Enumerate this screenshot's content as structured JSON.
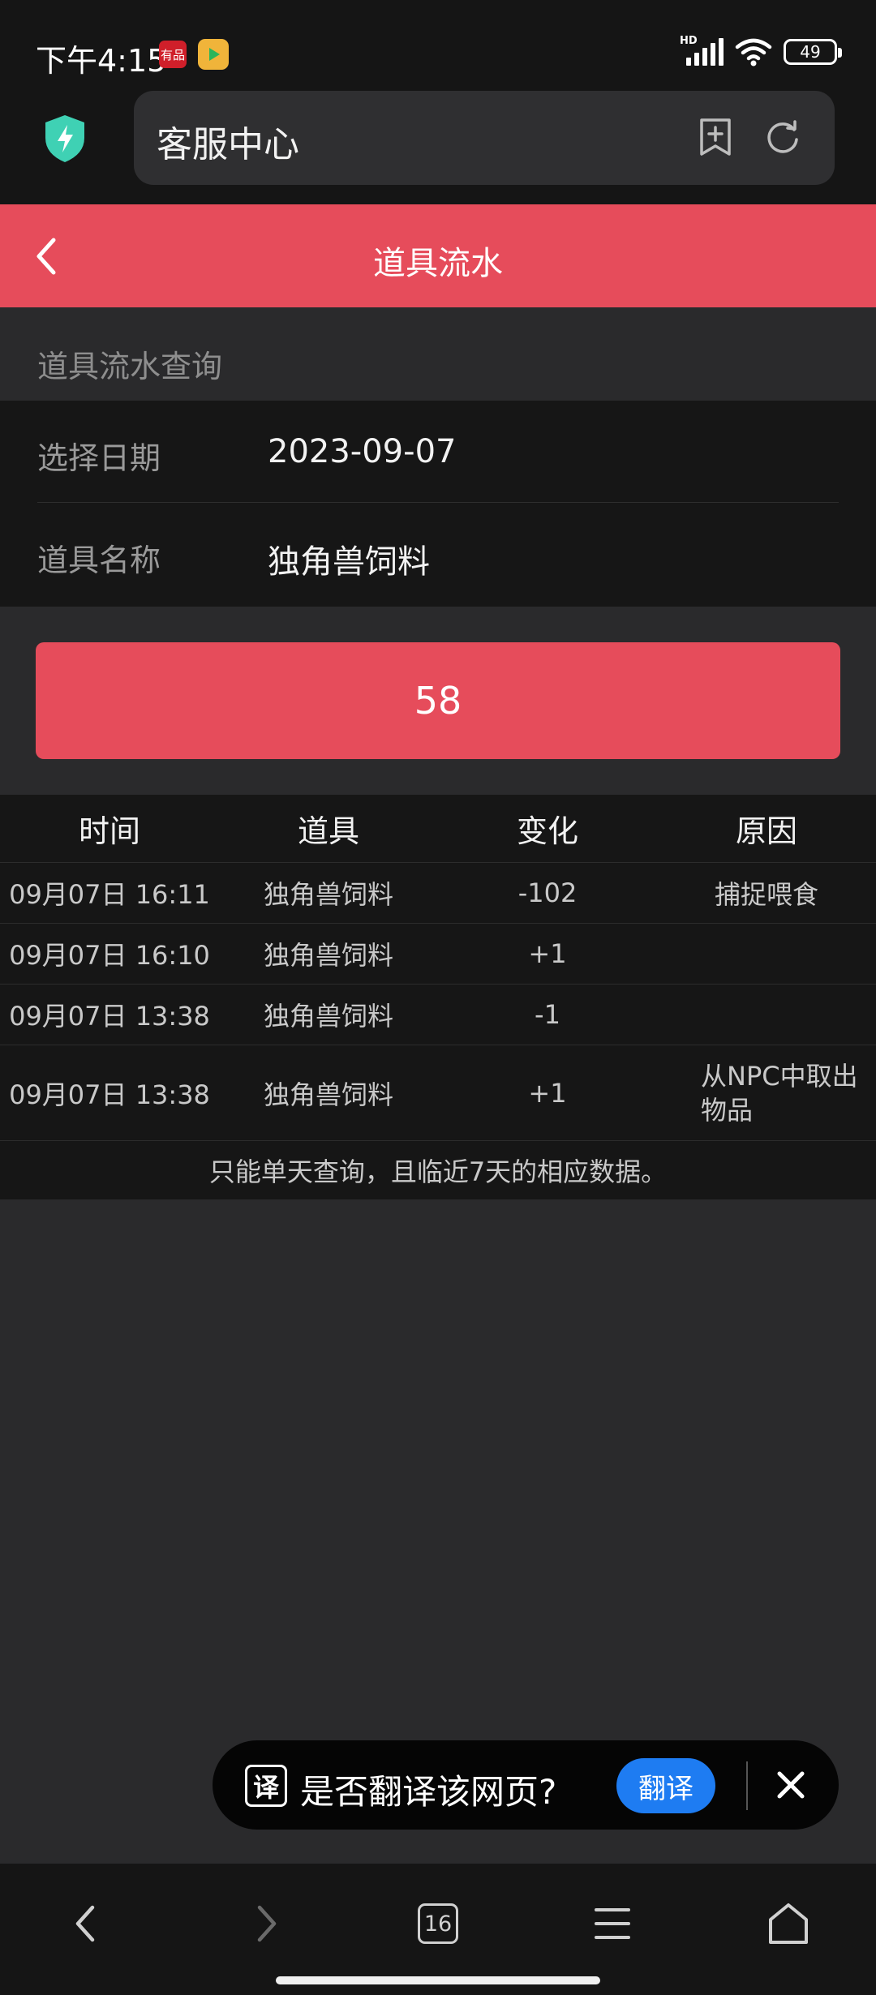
{
  "status_bar": {
    "time": "下午4:15",
    "red_badge_text": "有品",
    "network": "HD",
    "battery": "49"
  },
  "browser": {
    "address_text": "客服中心",
    "tab_count": "16"
  },
  "header": {
    "title": "道具流水"
  },
  "query": {
    "section_title": "道具流水查询",
    "date_label": "选择日期",
    "date_value": "2023-09-07",
    "item_label": "道具名称",
    "item_value": "独角兽饲料",
    "count_button": "58"
  },
  "table": {
    "headers": [
      "时间",
      "道具",
      "变化",
      "原因"
    ],
    "rows": [
      {
        "time": "09月07日 16:11",
        "item": "独角兽饲料",
        "change": "-102",
        "reason": "捕捉喂食"
      },
      {
        "time": "09月07日 16:10",
        "item": "独角兽饲料",
        "change": "+1",
        "reason": ""
      },
      {
        "time": "09月07日 13:38",
        "item": "独角兽饲料",
        "change": "-1",
        "reason": ""
      },
      {
        "time": "09月07日 13:38",
        "item": "独角兽饲料",
        "change": "+1",
        "reason": "从NPC中取出物品"
      }
    ],
    "note": "只能单天查询，且临近7天的相应数据。"
  },
  "translate_prompt": {
    "icon_text": "译",
    "question": "是否翻译该网页?",
    "button": "翻译"
  },
  "colors": {
    "accent": "#e64c5b",
    "translate_blue": "#1e7cf2",
    "shield": "#3fd1b4"
  }
}
